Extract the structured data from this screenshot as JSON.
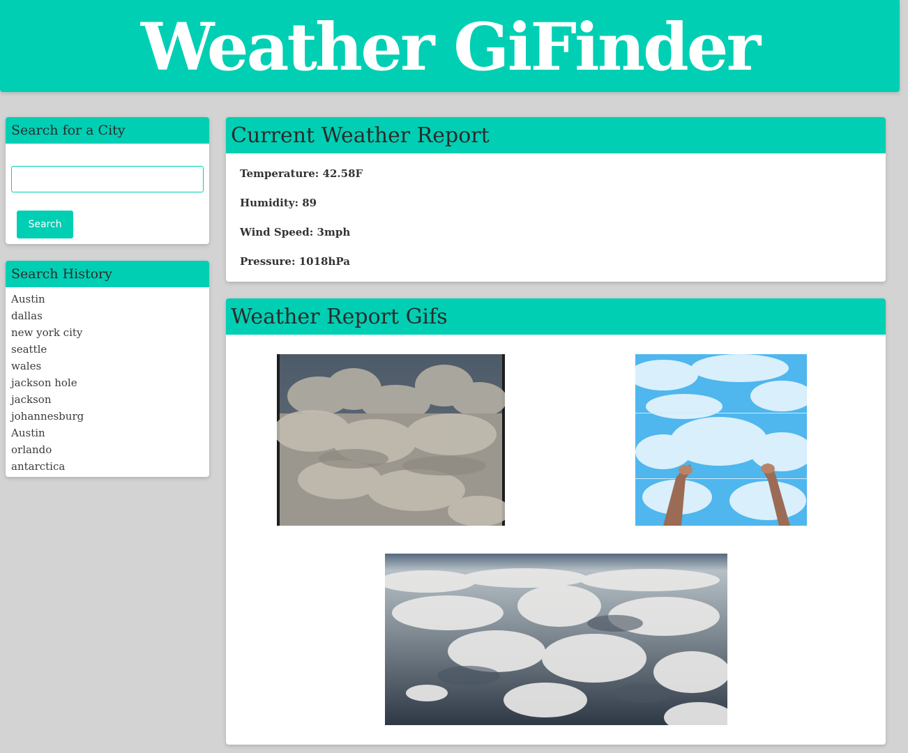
{
  "app": {
    "title": "Weather GiFinder"
  },
  "search": {
    "heading": "Search for a City",
    "input_value": "",
    "button_label": "Search"
  },
  "history": {
    "heading": "Search History",
    "items": [
      "Austin",
      "dallas",
      "new york city",
      "seattle",
      "wales",
      "jackson hole",
      "jackson",
      "johannesburg",
      "Austin",
      "orlando",
      "antarctica"
    ]
  },
  "report": {
    "heading": "Current Weather Report",
    "temperature": "Temperature: 42.58F",
    "humidity": "Humidity: 89",
    "wind_speed": "Wind Speed: 3mph",
    "pressure": "Pressure: 1018hPa"
  },
  "gifs": {
    "heading": "Weather Report Gifs"
  },
  "colors": {
    "accent": "#00cfb4",
    "background": "#d3d3d3",
    "card": "#ffffff",
    "heading_text": "#2b2b2b"
  }
}
